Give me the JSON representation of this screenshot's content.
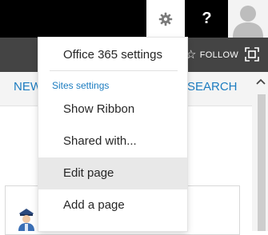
{
  "suite_bar": {
    "help_label": "?"
  },
  "ribbon": {
    "follow_label": "FOLLOW"
  },
  "nav": {
    "left_partial": "NEW",
    "right_partial": "SEARCH"
  },
  "settings_menu": {
    "office365_settings": "Office 365 settings",
    "section_label": "Sites settings",
    "items": [
      {
        "label": "Show Ribbon",
        "highlighted": false
      },
      {
        "label": "Shared with...",
        "highlighted": false
      },
      {
        "label": "Edit page",
        "highlighted": true
      },
      {
        "label": "Add a page",
        "highlighted": false
      }
    ]
  },
  "icons": {
    "gear": "gear-icon",
    "help": "help-icon",
    "profile": "profile-avatar-icon",
    "star": "star-icon",
    "focus": "focus-content-icon",
    "officer": "officer-icon",
    "scroll_up": "chevron-up-icon"
  },
  "colors": {
    "suite_bar": "#000000",
    "ribbon_bar": "#444444",
    "link_blue": "#1b7cc0",
    "highlight": "#e8e8e8"
  }
}
